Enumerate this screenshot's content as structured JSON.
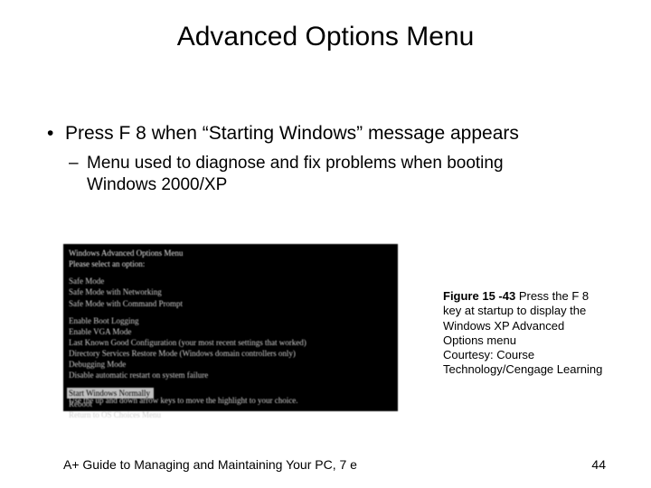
{
  "title": "Advanced Options Menu",
  "bullet1": "Press F 8 when “Starting Windows” message appears",
  "bullet2": "Menu used to diagnose and fix problems when booting Windows 2000/XP",
  "screenshot": {
    "header1": "Windows Advanced Options Menu",
    "header2": "Please select an option:",
    "opt_safe": "Safe Mode",
    "opt_safe_net": "Safe Mode with Networking",
    "opt_safe_cmd": "Safe Mode with Command Prompt",
    "opt_bootlog": "Enable Boot Logging",
    "opt_vga": "Enable VGA Mode",
    "opt_lkgc": "Last Known Good Configuration (your most recent settings that worked)",
    "opt_dsrm": "Directory Services Restore Mode (Windows domain controllers only)",
    "opt_debug": "Debugging Mode",
    "opt_noauto": "Disable automatic restart on system failure",
    "opt_start": "Start Windows Normally",
    "opt_reboot": "Reboot",
    "opt_return": "Return to OS Choices Menu",
    "hint": "Use the up and down arrow keys to move the highlight to your choice."
  },
  "caption": {
    "figure_label": "Figure 15 -43",
    "text": " Press the F 8 key at startup to display the Windows XP Advanced Options menu",
    "courtesy": "Courtesy: Course Technology/Cengage Learning"
  },
  "footer": {
    "left": "A+ Guide to Managing and Maintaining Your PC, 7 e",
    "right": "44"
  }
}
